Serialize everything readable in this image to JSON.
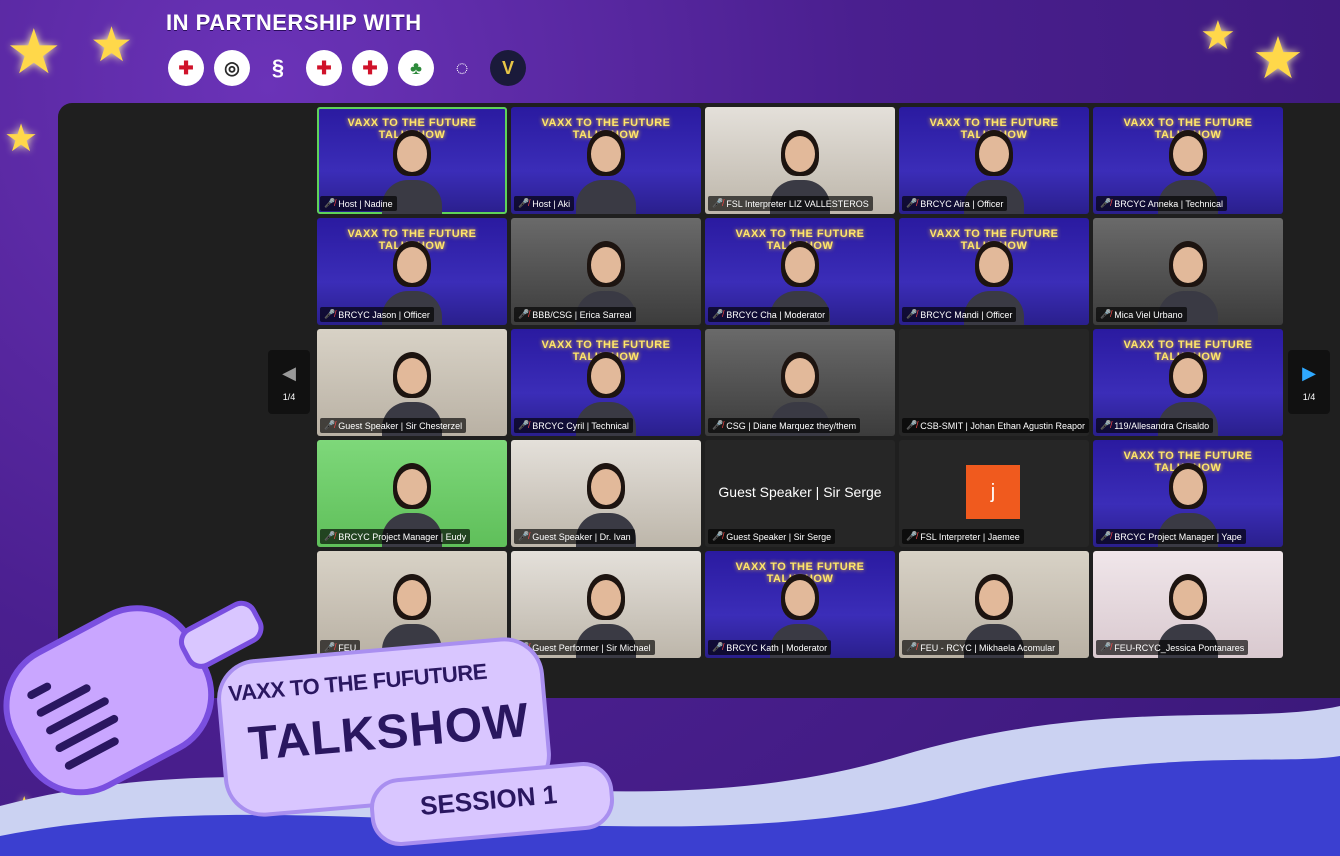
{
  "header": {
    "partner_title": "IN PARTNERSHIP WITH",
    "logos": [
      {
        "icon": "red-cross-adamson-logo"
      },
      {
        "icon": "swirl-logo"
      },
      {
        "icon": "s-logo"
      },
      {
        "icon": "red-cross-seal-logo"
      },
      {
        "icon": "red-cross-logo"
      },
      {
        "icon": "green-emblem-logo"
      },
      {
        "icon": "up-speed-logo"
      },
      {
        "icon": "v-shield-logo"
      }
    ]
  },
  "meeting": {
    "banner_text": "VAXX TO THE FUTURE TALKSHOW",
    "page_indicator_prev": "1/4",
    "page_indicator_next": "1/4",
    "participants": [
      {
        "name": "Host | Nadine",
        "style": "banner",
        "active": true
      },
      {
        "name": "Host | Aki",
        "style": "banner"
      },
      {
        "name": "FSL Interpreter LIZ VALLESTEROS",
        "style": "room-light"
      },
      {
        "name": "BRCYC Aira | Officer",
        "style": "banner"
      },
      {
        "name": "BRCYC Anneka | Technical",
        "style": "banner"
      },
      {
        "name": "BRCYC Jason | Officer",
        "style": "banner"
      },
      {
        "name": "BBB/CSG | Erica Sarreal",
        "style": "room-gray"
      },
      {
        "name": "BRCYC Cha | Moderator",
        "style": "banner"
      },
      {
        "name": "BRCYC Mandi | Officer",
        "style": "banner"
      },
      {
        "name": "Mica Viel Urbano",
        "style": "room-gray"
      },
      {
        "name": "Guest Speaker | Sir Chesterzel",
        "style": "room-beige"
      },
      {
        "name": "BRCYC Cyril | Technical",
        "style": "banner"
      },
      {
        "name": "CSG | Diane Marquez they/them",
        "style": "room-gray"
      },
      {
        "name": "CSB-SMIT | Johan Ethan Agustin Reapor",
        "style": "room-dark",
        "no_video": true
      },
      {
        "name": "119/Allesandra Crisaldo",
        "style": "banner"
      },
      {
        "name": "BRCYC Project Manager | Eudy",
        "style": "room-green"
      },
      {
        "name": "Guest Speaker | Dr. Ivan",
        "style": "room-light"
      },
      {
        "name": "Guest Speaker | Sir Serge",
        "style": "room-dark",
        "no_video": true,
        "display_name": "Guest Speaker | Sir Serge"
      },
      {
        "name": "FSL Interpreter | Jaemee",
        "style": "room-dark",
        "no_video": true,
        "avatar_letter": "j"
      },
      {
        "name": "BRCYC Project Manager | Yape",
        "style": "banner"
      },
      {
        "name": "FEU",
        "style": "room-beige"
      },
      {
        "name": "Guest Performer | Sir Michael",
        "style": "room-light"
      },
      {
        "name": "BRCYC Kath | Moderator",
        "style": "banner"
      },
      {
        "name": "FEU - RCYC | Mikhaela Acomular",
        "style": "room-beige"
      },
      {
        "name": "FEU-RCYC_Jessica Pontanares",
        "style": "room-pink"
      }
    ]
  },
  "branding": {
    "line1": "VAXX TO THE FUFUTURE",
    "line2": "TALKSHOW",
    "session": "SESSION 1"
  },
  "colors": {
    "frame": "#4a1f8f",
    "star": "#ffd84a",
    "active_border": "#5fd35a",
    "mute": "#ff4a4a",
    "next_arrow": "#2fa9ff"
  }
}
